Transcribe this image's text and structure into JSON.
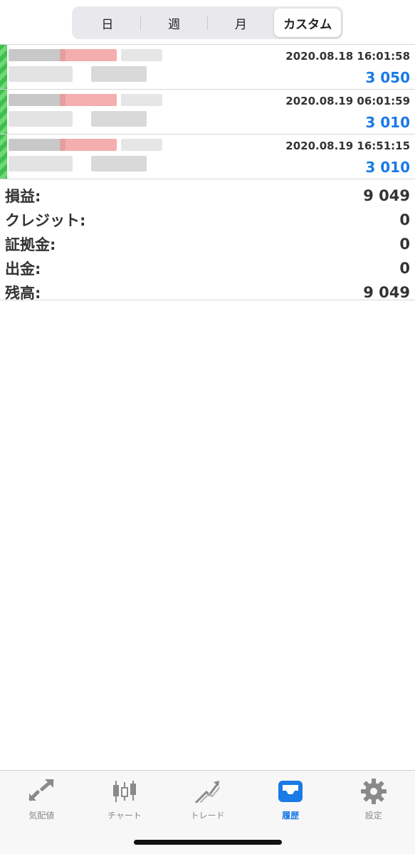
{
  "period_tabs": [
    {
      "label": "日",
      "active": false
    },
    {
      "label": "週",
      "active": false
    },
    {
      "label": "月",
      "active": false
    },
    {
      "label": "カスタム",
      "active": true
    }
  ],
  "deals": [
    {
      "time": "2020.08.18 16:01:58",
      "profit": "3 050"
    },
    {
      "time": "2020.08.19 06:01:59",
      "profit": "3 010"
    },
    {
      "time": "2020.08.19 16:51:15",
      "profit": "3 010"
    }
  ],
  "summary": {
    "profit_label": "損益:",
    "profit_value": "9 049",
    "credit_label": "クレジット:",
    "credit_value": "0",
    "deposit_label": "証拠金:",
    "deposit_value": "0",
    "withdraw_label": "出金:",
    "withdraw_value": "0",
    "balance_label": "残高:",
    "balance_value": "9 049"
  },
  "tabbar": [
    {
      "label": "気配値",
      "icon": "quotes-icon",
      "active": false
    },
    {
      "label": "チャート",
      "icon": "chart-icon",
      "active": false
    },
    {
      "label": "トレード",
      "icon": "trade-icon",
      "active": false
    },
    {
      "label": "履歴",
      "icon": "history-icon",
      "active": true
    },
    {
      "label": "設定",
      "icon": "settings-icon",
      "active": false
    }
  ],
  "colors": {
    "accent": "#1a7ae6",
    "buy_stripe": "#3fbf4a",
    "inactive": "#8a8a8a"
  }
}
